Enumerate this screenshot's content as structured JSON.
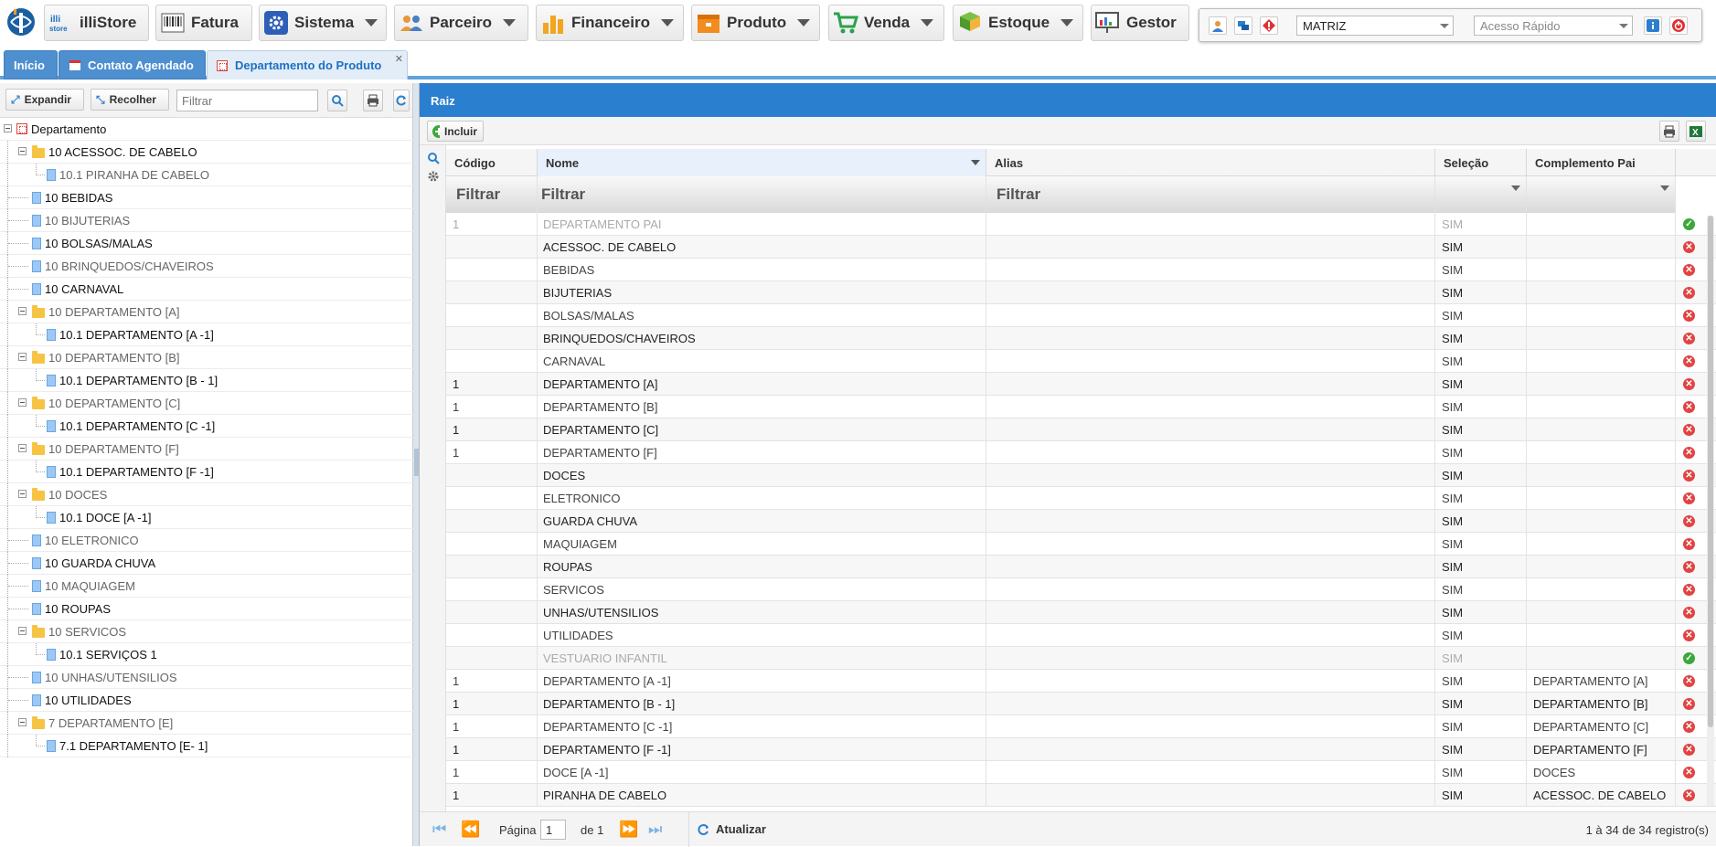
{
  "nav": {
    "items": [
      {
        "label": "illiStore",
        "icon": "illistore-icon"
      },
      {
        "label": "Fatura",
        "icon": "boleto-icon"
      },
      {
        "label": "Sistema",
        "icon": "gear-icon"
      },
      {
        "label": "Parceiro",
        "icon": "people-icon"
      },
      {
        "label": "Financeiro",
        "icon": "bar-chart-icon"
      },
      {
        "label": "Produto",
        "icon": "box-icon"
      },
      {
        "label": "Venda",
        "icon": "cart-icon"
      },
      {
        "label": "Estoque",
        "icon": "stock-icon"
      },
      {
        "label": "Gestor",
        "icon": "dashboard-icon"
      }
    ],
    "branch": "MATRIZ",
    "quick_access_placeholder": "Acesso Rápido"
  },
  "tabs": [
    {
      "label": "Início"
    },
    {
      "label": "Contato Agendado"
    },
    {
      "label": "Departamento do Produto"
    }
  ],
  "left": {
    "expand_label": "Expandir",
    "collapse_label": "Recolher",
    "filter_placeholder": "Filtrar",
    "tree": [
      {
        "label": "Departamento",
        "level": 0,
        "type": "root"
      },
      {
        "label": "10 ACESSOC. DE CABELO",
        "level": 1,
        "type": "folder",
        "dark": true
      },
      {
        "label": "10.1 PIRANHA DE CABELO",
        "level": 2,
        "type": "doc",
        "dark": false
      },
      {
        "label": "10 BEBIDAS",
        "level": 1,
        "type": "doc",
        "dark": true
      },
      {
        "label": "10 BIJUTERIAS",
        "level": 1,
        "type": "doc",
        "dark": false
      },
      {
        "label": "10 BOLSAS/MALAS",
        "level": 1,
        "type": "doc",
        "dark": true
      },
      {
        "label": "10 BRINQUEDOS/CHAVEIROS",
        "level": 1,
        "type": "doc",
        "dark": false
      },
      {
        "label": "10 CARNAVAL",
        "level": 1,
        "type": "doc",
        "dark": true
      },
      {
        "label": "10 DEPARTAMENTO [A]",
        "level": 1,
        "type": "folder",
        "dark": false
      },
      {
        "label": "10.1 DEPARTAMENTO [A -1]",
        "level": 2,
        "type": "doc",
        "dark": true
      },
      {
        "label": "10 DEPARTAMENTO [B]",
        "level": 1,
        "type": "folder",
        "dark": false
      },
      {
        "label": "10.1 DEPARTAMENTO [B - 1]",
        "level": 2,
        "type": "doc",
        "dark": true
      },
      {
        "label": "10 DEPARTAMENTO [C]",
        "level": 1,
        "type": "folder",
        "dark": false
      },
      {
        "label": "10.1 DEPARTAMENTO [C -1]",
        "level": 2,
        "type": "doc",
        "dark": true
      },
      {
        "label": "10 DEPARTAMENTO [F]",
        "level": 1,
        "type": "folder",
        "dark": false
      },
      {
        "label": "10.1 DEPARTAMENTO [F -1]",
        "level": 2,
        "type": "doc",
        "dark": true
      },
      {
        "label": "10 DOCES",
        "level": 1,
        "type": "folder",
        "dark": false
      },
      {
        "label": "10.1 DOCE [A -1]",
        "level": 2,
        "type": "doc",
        "dark": true
      },
      {
        "label": "10 ELETRONICO",
        "level": 1,
        "type": "doc",
        "dark": false
      },
      {
        "label": "10 GUARDA CHUVA",
        "level": 1,
        "type": "doc",
        "dark": true
      },
      {
        "label": "10 MAQUIAGEM",
        "level": 1,
        "type": "doc",
        "dark": false
      },
      {
        "label": "10 ROUPAS",
        "level": 1,
        "type": "doc",
        "dark": true
      },
      {
        "label": "10 SERVICOS",
        "level": 1,
        "type": "folder",
        "dark": false
      },
      {
        "label": "10.1 SERVIÇOS 1",
        "level": 2,
        "type": "doc",
        "dark": true
      },
      {
        "label": "10 UNHAS/UTENSILIOS",
        "level": 1,
        "type": "doc",
        "dark": false
      },
      {
        "label": "10 UTILIDADES",
        "level": 1,
        "type": "doc",
        "dark": true
      },
      {
        "label": "7 DEPARTAMENTO [E]",
        "level": 1,
        "type": "folder",
        "dark": false
      },
      {
        "label": "7.1 DEPARTAMENTO [E- 1]",
        "level": 2,
        "type": "doc",
        "dark": true
      }
    ]
  },
  "right": {
    "title": "Raiz",
    "add_label": "Incluir",
    "columns": [
      "Código",
      "Nome",
      "Alias",
      "Seleção",
      "Complemento Pai"
    ],
    "filter_text": "Filtrar",
    "rows": [
      {
        "codigo": "1",
        "nome": "DEPARTAMENTO PAI",
        "alias": "",
        "selecao": "SIM",
        "pai": "",
        "ok": true,
        "style": "dimmed"
      },
      {
        "codigo": "",
        "nome": "ACESSOC. DE CABELO",
        "alias": "",
        "selecao": "SIM",
        "pai": "",
        "ok": false,
        "style": "dark"
      },
      {
        "codigo": "",
        "nome": "BEBIDAS",
        "alias": "",
        "selecao": "SIM",
        "pai": "",
        "ok": false,
        "style": "lt"
      },
      {
        "codigo": "",
        "nome": "BIJUTERIAS",
        "alias": "",
        "selecao": "SIM",
        "pai": "",
        "ok": false,
        "style": "dark"
      },
      {
        "codigo": "",
        "nome": "BOLSAS/MALAS",
        "alias": "",
        "selecao": "SIM",
        "pai": "",
        "ok": false,
        "style": "lt"
      },
      {
        "codigo": "",
        "nome": "BRINQUEDOS/CHAVEIROS",
        "alias": "",
        "selecao": "SIM",
        "pai": "",
        "ok": false,
        "style": "dark"
      },
      {
        "codigo": "",
        "nome": "CARNAVAL",
        "alias": "",
        "selecao": "SIM",
        "pai": "",
        "ok": false,
        "style": "lt"
      },
      {
        "codigo": "1",
        "nome": "DEPARTAMENTO [A]",
        "alias": "",
        "selecao": "SIM",
        "pai": "",
        "ok": false,
        "style": "dark"
      },
      {
        "codigo": "1",
        "nome": "DEPARTAMENTO [B]",
        "alias": "",
        "selecao": "SIM",
        "pai": "",
        "ok": false,
        "style": "lt"
      },
      {
        "codigo": "1",
        "nome": "DEPARTAMENTO [C]",
        "alias": "",
        "selecao": "SIM",
        "pai": "",
        "ok": false,
        "style": "dark"
      },
      {
        "codigo": "1",
        "nome": "DEPARTAMENTO [F]",
        "alias": "",
        "selecao": "SIM",
        "pai": "",
        "ok": false,
        "style": "lt"
      },
      {
        "codigo": "",
        "nome": "DOCES",
        "alias": "",
        "selecao": "SIM",
        "pai": "",
        "ok": false,
        "style": "dark"
      },
      {
        "codigo": "",
        "nome": "ELETRONICO",
        "alias": "",
        "selecao": "SIM",
        "pai": "",
        "ok": false,
        "style": "lt"
      },
      {
        "codigo": "",
        "nome": "GUARDA CHUVA",
        "alias": "",
        "selecao": "SIM",
        "pai": "",
        "ok": false,
        "style": "dark"
      },
      {
        "codigo": "",
        "nome": "MAQUIAGEM",
        "alias": "",
        "selecao": "SIM",
        "pai": "",
        "ok": false,
        "style": "lt"
      },
      {
        "codigo": "",
        "nome": "ROUPAS",
        "alias": "",
        "selecao": "SIM",
        "pai": "",
        "ok": false,
        "style": "dark"
      },
      {
        "codigo": "",
        "nome": "SERVICOS",
        "alias": "",
        "selecao": "SIM",
        "pai": "",
        "ok": false,
        "style": "lt"
      },
      {
        "codigo": "",
        "nome": "UNHAS/UTENSILIOS",
        "alias": "",
        "selecao": "SIM",
        "pai": "",
        "ok": false,
        "style": "dark"
      },
      {
        "codigo": "",
        "nome": "UTILIDADES",
        "alias": "",
        "selecao": "SIM",
        "pai": "",
        "ok": false,
        "style": "lt"
      },
      {
        "codigo": "",
        "nome": "VESTUARIO INFANTIL",
        "alias": "",
        "selecao": "SIM",
        "pai": "",
        "ok": true,
        "style": "dimmed"
      },
      {
        "codigo": "1",
        "nome": "DEPARTAMENTO [A -1]",
        "alias": "",
        "selecao": "SIM",
        "pai": "DEPARTAMENTO [A]",
        "ok": false,
        "style": "lt"
      },
      {
        "codigo": "1",
        "nome": "DEPARTAMENTO [B - 1]",
        "alias": "",
        "selecao": "SIM",
        "pai": "DEPARTAMENTO [B]",
        "ok": false,
        "style": "dark"
      },
      {
        "codigo": "1",
        "nome": "DEPARTAMENTO [C -1]",
        "alias": "",
        "selecao": "SIM",
        "pai": "DEPARTAMENTO [C]",
        "ok": false,
        "style": "lt"
      },
      {
        "codigo": "1",
        "nome": "DEPARTAMENTO [F -1]",
        "alias": "",
        "selecao": "SIM",
        "pai": "DEPARTAMENTO [F]",
        "ok": false,
        "style": "dark"
      },
      {
        "codigo": "1",
        "nome": "DOCE [A -1]",
        "alias": "",
        "selecao": "SIM",
        "pai": "DOCES",
        "ok": false,
        "style": "lt"
      },
      {
        "codigo": "1",
        "nome": "PIRANHA DE CABELO",
        "alias": "",
        "selecao": "SIM",
        "pai": "ACESSOC. DE CABELO",
        "ok": false,
        "style": "dark"
      }
    ],
    "pager": {
      "page_label": "Página",
      "page": "1",
      "of_label": "de 1",
      "refresh_label": "Atualizar",
      "records": "1 à 34 de 34 registro(s)"
    }
  },
  "colors": {
    "accent": "#2a7fce",
    "tab_dark": "#4d8fcf",
    "ok": "#3aa83a",
    "error": "#e14343",
    "folder": "#f6c343"
  }
}
